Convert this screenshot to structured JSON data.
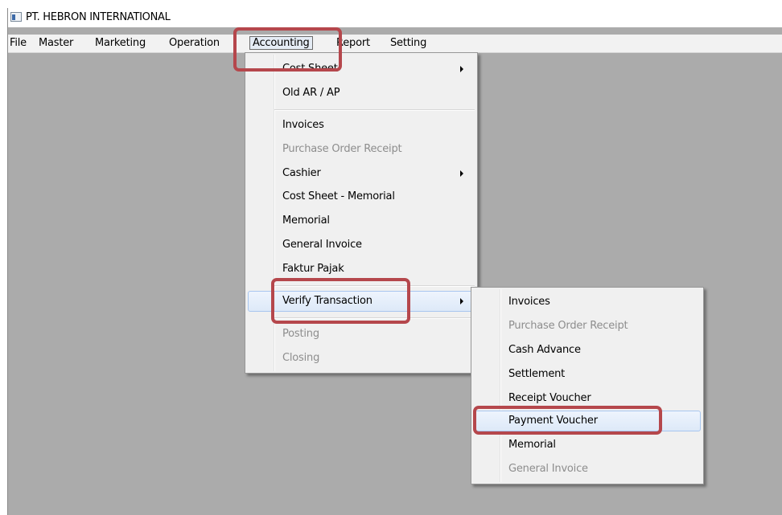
{
  "window": {
    "title": "PT. HEBRON INTERNATIONAL"
  },
  "menubar": {
    "items": [
      {
        "label": "File"
      },
      {
        "label": "Master"
      },
      {
        "label": "Marketing"
      },
      {
        "label": "Operation"
      },
      {
        "label": "Accounting"
      },
      {
        "label": "Report"
      },
      {
        "label": "Setting"
      }
    ]
  },
  "accounting_menu": {
    "items": [
      {
        "label": "Cost Sheet",
        "has_submenu": true,
        "enabled": true
      },
      {
        "label": "Old AR / AP",
        "enabled": true
      },
      {
        "label": "Invoices",
        "enabled": true
      },
      {
        "label": "Purchase Order Receipt",
        "enabled": false
      },
      {
        "label": "Cashier",
        "has_submenu": true,
        "enabled": true
      },
      {
        "label": "Cost Sheet - Memorial",
        "enabled": true
      },
      {
        "label": "Memorial",
        "enabled": true
      },
      {
        "label": "General Invoice",
        "enabled": true
      },
      {
        "label": "Faktur Pajak",
        "enabled": true
      },
      {
        "label": "Verify Transaction",
        "has_submenu": true,
        "enabled": true,
        "highlighted": true
      },
      {
        "label": "Posting",
        "enabled": false
      },
      {
        "label": "Closing",
        "enabled": false
      }
    ]
  },
  "verify_submenu": {
    "items": [
      {
        "label": "Invoices",
        "enabled": true
      },
      {
        "label": "Purchase Order Receipt",
        "enabled": false
      },
      {
        "label": "Cash Advance",
        "enabled": true
      },
      {
        "label": "Settlement",
        "enabled": true
      },
      {
        "label": "Receipt Voucher",
        "enabled": true
      },
      {
        "label": "Payment Voucher",
        "enabled": true,
        "highlighted": true
      },
      {
        "label": "Memorial",
        "enabled": true
      },
      {
        "label": "General Invoice",
        "enabled": false
      }
    ]
  },
  "colors": {
    "annotation": "#b5474c",
    "background": "#ababab",
    "menu": "#f0f0f0",
    "disabled_text": "#8d8d8d"
  }
}
